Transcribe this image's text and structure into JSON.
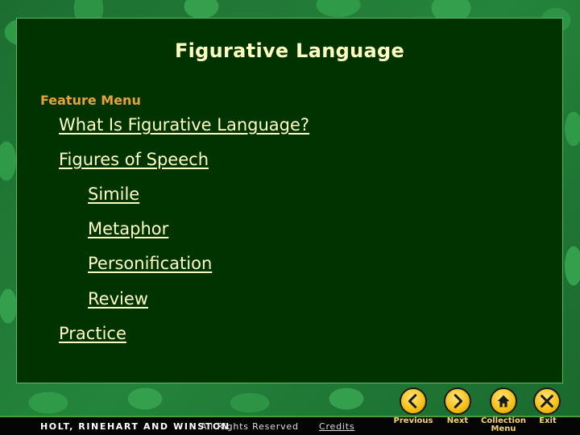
{
  "slide": {
    "title": "Figurative Language",
    "section_label": "Feature Menu",
    "menu": [
      {
        "label": "What Is Figurative Language?",
        "level": 1
      },
      {
        "label": "Figures of Speech",
        "level": 1
      },
      {
        "label": "Simile",
        "level": 2
      },
      {
        "label": "Metaphor",
        "level": 2
      },
      {
        "label": "Personification",
        "level": 2
      },
      {
        "label": "Review",
        "level": 2
      },
      {
        "label": "Practice",
        "level": 1
      }
    ]
  },
  "footer": {
    "publisher": "HOLT, RINEHART AND WINSTON",
    "rights": "All Rights Reserved",
    "credits": "Credits"
  },
  "nav": {
    "previous": {
      "label": "Previous",
      "icon": "chevron-left-icon"
    },
    "next": {
      "label": "Next",
      "icon": "chevron-right-icon"
    },
    "collection_menu": {
      "label_line1": "Collection",
      "label_line2": "Menu",
      "icon": "home-icon"
    },
    "exit": {
      "label": "Exit",
      "icon": "close-icon"
    }
  },
  "colors": {
    "panel_bg": "#003300",
    "title_text": "#ffffc0",
    "section_label": "#e8a236",
    "nav_label": "#f3d36a",
    "button_gold": "#f7c21a"
  }
}
